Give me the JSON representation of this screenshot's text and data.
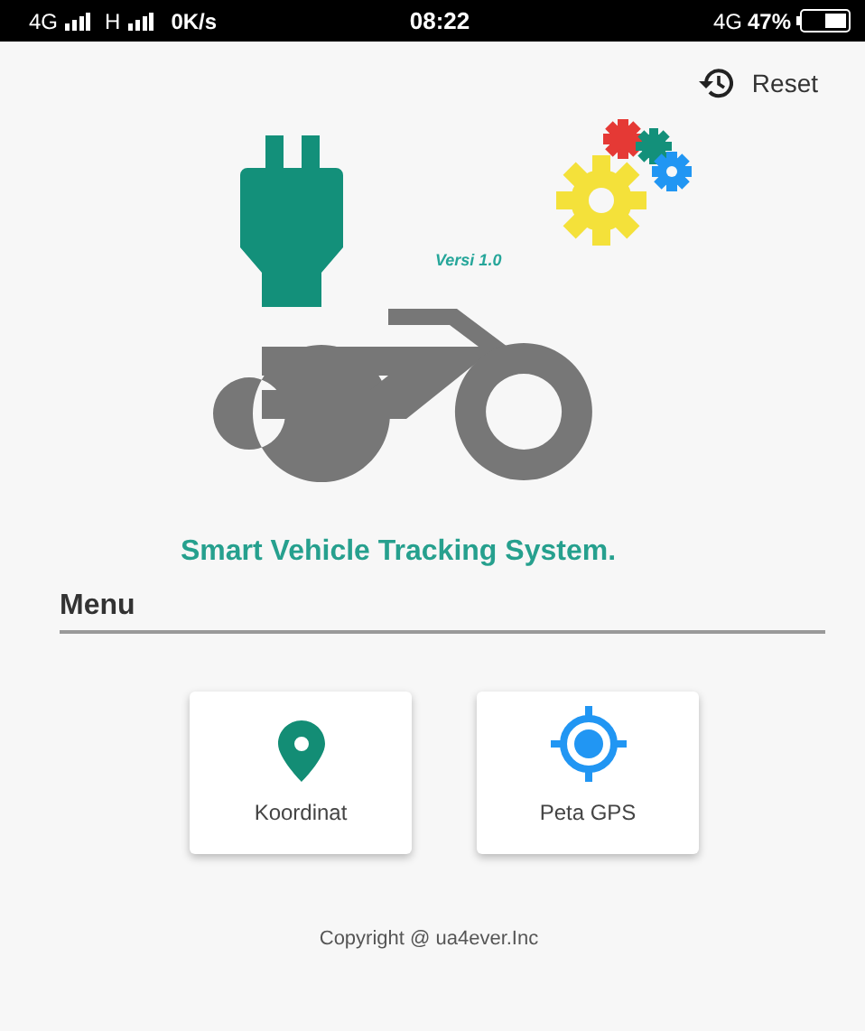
{
  "status_bar": {
    "network_1": "4G",
    "network_2": "H",
    "speed": "0K/s",
    "time": "08:22",
    "network_3": "4G",
    "battery": "47%"
  },
  "toolbar": {
    "reset_label": "Reset"
  },
  "logo": {
    "version": "Versi 1.0"
  },
  "app_title": "Smart Vehicle Tracking System.",
  "menu": {
    "heading": "Menu",
    "items": [
      {
        "kind": "pin",
        "label": "Koordinat"
      },
      {
        "kind": "target",
        "label": "Peta GPS"
      }
    ]
  },
  "footer": "Copyright @ ua4ever.Inc"
}
